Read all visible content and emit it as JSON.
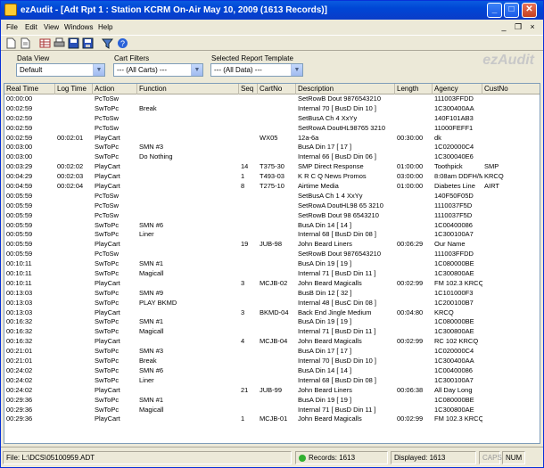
{
  "window": {
    "title": "ezAudit - [Adt Rpt 1 :  Station KCRM On-Air May 10, 2009 (1613 Records)]"
  },
  "menu": [
    "File",
    "Edit",
    "View",
    "Windows",
    "Help"
  ],
  "toolbar": [
    "new-icon",
    "open-icon",
    "grid-icon",
    "print-icon",
    "save-icon",
    "save-all-icon",
    "filter-icon",
    "help-icon"
  ],
  "filters": {
    "data_view": {
      "label": "Data View",
      "value": "Default"
    },
    "cart_filters": {
      "label": "Cart Filters",
      "value": "--- (All Carts) ---"
    },
    "report_template": {
      "label": "Selected Report Template",
      "value": "--- (All Data) ---"
    }
  },
  "watermark": "ezAudit",
  "columns": [
    "Real Time",
    "Log Time",
    "Action",
    "Function",
    "Seq",
    "CartNo",
    "Description",
    "Length",
    "Agency",
    "CustNo"
  ],
  "rows": [
    [
      "00:00:00",
      "",
      "PcToSw",
      "",
      "",
      "",
      "SetRowB Dout  9876543210",
      "",
      "111003FFDD",
      ""
    ],
    [
      "00:02:59",
      "",
      "SwToPc",
      "Break",
      "",
      "",
      "Internal 70 [ BusD Din 10 ]",
      "",
      "1C300400AA",
      ""
    ],
    [
      "00:02:59",
      "",
      "PcToSw",
      "",
      "",
      "",
      "SetBusA Ch   4     XxYy",
      "",
      "140F101AB3",
      ""
    ],
    [
      "00:02:59",
      "",
      "PcToSw",
      "",
      "",
      "",
      "SetRowA DoutHL98765 3210",
      "",
      "11000FEFF1",
      ""
    ],
    [
      "00:02:59",
      "00:02:01",
      "PlayCart",
      "",
      "",
      "WX05",
      "12a-6a",
      "00:30:00",
      "dk",
      ""
    ],
    [
      "00:03:00",
      "",
      "SwToPc",
      "SMN #3",
      "",
      "",
      "BusA Din 17 [ 17 ]",
      "",
      "1C020000C4",
      ""
    ],
    [
      "00:03:00",
      "",
      "SwToPc",
      "Do Nothing",
      "",
      "",
      "Internal 66 [ BusD Din 06 ]",
      "",
      "1C300040E6",
      ""
    ],
    [
      "00:03:29",
      "00:02:02",
      "PlayCart",
      "",
      "14",
      "T375-30",
      "SMP Direct Response",
      "01:00:00",
      "Toothpick",
      "SMP"
    ],
    [
      "00:04:29",
      "00:02:03",
      "PlayCart",
      "",
      "1",
      "T493-03",
      "K R C Q News Promos",
      "03:00:00",
      "8:08am DDFH/MB",
      "KRCQ"
    ],
    [
      "00:04:59",
      "00:02:04",
      "PlayCart",
      "",
      "8",
      "T275-10",
      "Airtime Media",
      "01:00:00",
      "Diabetes Line",
      "AIRT"
    ],
    [
      "00:05:59",
      "",
      "PcToSw",
      "",
      "",
      "",
      "SetBusA Ch 1   4     XxYy",
      "",
      "140F50F05D",
      ""
    ],
    [
      "00:05:59",
      "",
      "PcToSw",
      "",
      "",
      "",
      "SetRowA DoutHL98 65 3210",
      "",
      "1110037F5D",
      ""
    ],
    [
      "00:05:59",
      "",
      "PcToSw",
      "",
      "",
      "",
      "SetRowB Dout  98 6543210",
      "",
      "1110037F5D",
      ""
    ],
    [
      "00:05:59",
      "",
      "SwToPc",
      "SMN #6",
      "",
      "",
      "BusA Din 14 [ 14 ]",
      "",
      "1C00400086",
      ""
    ],
    [
      "00:05:59",
      "",
      "SwToPc",
      "Liner",
      "",
      "",
      "Internal 68 [ BusD Din 08 ]",
      "",
      "1C300100A7",
      ""
    ],
    [
      "00:05:59",
      "",
      "PlayCart",
      "",
      "19",
      "JUB-98",
      "John Beard Liners",
      "00:06:29",
      "Our Name",
      ""
    ],
    [
      "00:05:59",
      "",
      "PcToSw",
      "",
      "",
      "",
      "SetRowB Dout  9876543210",
      "",
      "111003FFDD",
      ""
    ],
    [
      "00:10:11",
      "",
      "SwToPc",
      "SMN #1",
      "",
      "",
      "BusA Din 19 [ 19 ]",
      "",
      "1C080000BE",
      ""
    ],
    [
      "00:10:11",
      "",
      "SwToPc",
      "Magicall",
      "",
      "",
      "Internal 71 [ BusD Din 11 ]",
      "",
      "1C300800AE",
      ""
    ],
    [
      "00:10:11",
      "",
      "PlayCart",
      "",
      "3",
      "MCJB-02",
      "John Beard Magicalls",
      "00:02:99",
      "FM 102.3 KRCQ",
      ""
    ],
    [
      "00:13:03",
      "",
      "SwToPc",
      "SMN #9",
      "",
      "",
      "BusB Din 12 [ 32 ]",
      "",
      "1C101000F3",
      ""
    ],
    [
      "00:13:03",
      "",
      "SwToPc",
      "PLAY BKMD",
      "",
      "",
      "Internal 48 [ BusC Din 08 ]",
      "",
      "1C200100B7",
      ""
    ],
    [
      "00:13:03",
      "",
      "PlayCart",
      "",
      "3",
      "BKMD-04",
      "Back End Jingle Medium",
      "00:04:80",
      "KRCQ",
      ""
    ],
    [
      "00:16:32",
      "",
      "SwToPc",
      "SMN #1",
      "",
      "",
      "BusA Din 19 [ 19 ]",
      "",
      "1C080000BE",
      ""
    ],
    [
      "00:16:32",
      "",
      "SwToPc",
      "Magicall",
      "",
      "",
      "Internal 71 [ BusD Din 11 ]",
      "",
      "1C300800AE",
      ""
    ],
    [
      "00:16:32",
      "",
      "PlayCart",
      "",
      "4",
      "MCJB-04",
      "John Beard Magicalls",
      "00:02:99",
      "RC 102 KRCQ",
      ""
    ],
    [
      "00:21:01",
      "",
      "SwToPc",
      "SMN #3",
      "",
      "",
      "BusA Din 17 [ 17 ]",
      "",
      "1C020000C4",
      ""
    ],
    [
      "00:21:01",
      "",
      "SwToPc",
      "Break",
      "",
      "",
      "Internal 70 [ BusD Din 10 ]",
      "",
      "1C300400AA",
      ""
    ],
    [
      "00:24:02",
      "",
      "SwToPc",
      "SMN #6",
      "",
      "",
      "BusA Din 14 [ 14 ]",
      "",
      "1C00400086",
      ""
    ],
    [
      "00:24:02",
      "",
      "SwToPc",
      "Liner",
      "",
      "",
      "Internal 68 [ BusD Din 08 ]",
      "",
      "1C300100A7",
      ""
    ],
    [
      "00:24:02",
      "",
      "PlayCart",
      "",
      "21",
      "JUB-99",
      "John Beard Liners",
      "00:06:38",
      "All Day Long",
      ""
    ],
    [
      "00:29:36",
      "",
      "SwToPc",
      "SMN #1",
      "",
      "",
      "BusA Din 19 [ 19 ]",
      "",
      "1C080000BE",
      ""
    ],
    [
      "00:29:36",
      "",
      "SwToPc",
      "Magicall",
      "",
      "",
      "Internal 71 [ BusD Din 11 ]",
      "",
      "1C300800AE",
      ""
    ],
    [
      "00:29:36",
      "",
      "PlayCart",
      "",
      "1",
      "MCJB-01",
      "John Beard Magicalls",
      "00:02:99",
      "FM 102.3 KRCQ",
      ""
    ]
  ],
  "status": {
    "file": "File: L:\\DCS\\05100959.ADT",
    "records": "Records: 1613",
    "displayed": "Displayed: 1613",
    "caps": "CAPS",
    "num": "NUM"
  }
}
